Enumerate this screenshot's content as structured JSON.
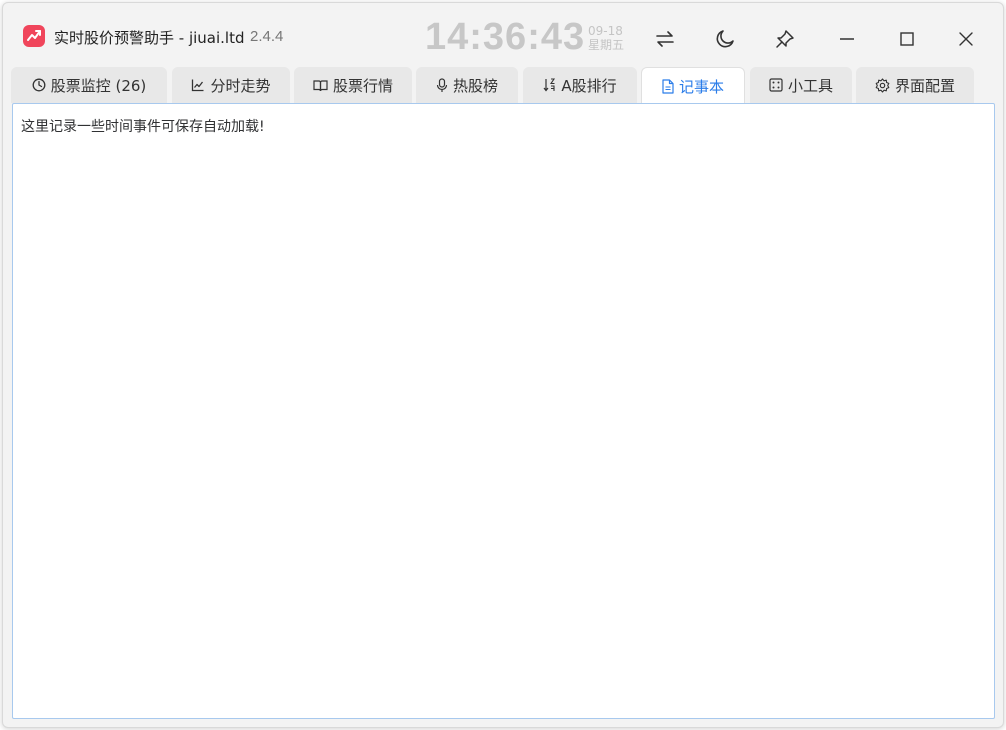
{
  "window": {
    "title": "实时股价预警助手 - jiuai.ltd",
    "version": "2.4.4",
    "icon": "stock-chart-icon",
    "accent": "#f0455b"
  },
  "clock": {
    "time": "14:36:43",
    "date": "09-18",
    "weekday": "星期五"
  },
  "toolbar": {
    "buttons": [
      "swap-icon",
      "moon-icon",
      "pin-icon",
      "minimize-icon",
      "maximize-icon",
      "close-icon"
    ]
  },
  "tabs": [
    {
      "label": "股票监控 (26)",
      "icon": "clock-icon"
    },
    {
      "label": "分时走势",
      "icon": "line-chart-icon"
    },
    {
      "label": "股票行情",
      "icon": "book-icon"
    },
    {
      "label": "热股榜",
      "icon": "microphone-icon"
    },
    {
      "label": "A股排行",
      "icon": "sort-icon"
    },
    {
      "label": "记事本",
      "icon": "document-icon",
      "active": true
    },
    {
      "label": "小工具",
      "icon": "grid-icon"
    },
    {
      "label": "界面配置",
      "icon": "gear-icon"
    }
  ],
  "notepad": {
    "content": "这里记录一些时间事件可保存自动加载!"
  },
  "colors": {
    "active_tab": "#2b7de9",
    "editor_border": "#a8c9ee",
    "clock": "#c7c7c7"
  }
}
